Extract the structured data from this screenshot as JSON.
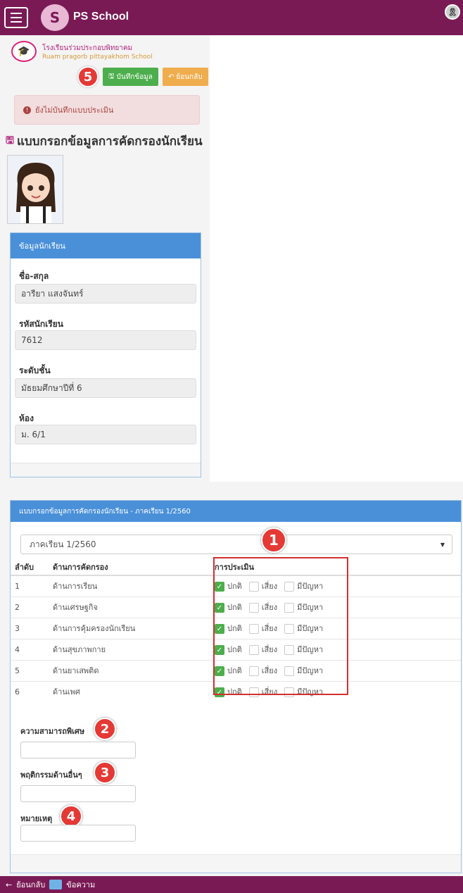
{
  "app": {
    "title": "PS School"
  },
  "school": {
    "name_th": "โรงเรียนร่วมประกอบพิทยาคม",
    "name_en": "Ruam pragorb pittayakhom School"
  },
  "toolbar": {
    "step_badge": "5",
    "save_label": "บันทึกข้อมูล",
    "back_label": "ย้อนกลับ"
  },
  "alert": {
    "text": "ยังไม่บันทึกแบบประเมิน"
  },
  "form": {
    "title": "แบบกรอกข้อมูลการคัดกรองนักเรียน"
  },
  "student_panel": {
    "heading": "ข้อมูลนักเรียน",
    "fields": [
      {
        "label": "ชื่อ-สกุล",
        "value": "อารียา แสงจันทร์"
      },
      {
        "label": "รหัสนักเรียน",
        "value": "7612"
      },
      {
        "label": "ระดับชั้น",
        "value": "มัธยมศึกษาปีที่ 6"
      },
      {
        "label": "ห้อง",
        "value": "ม. 6/1"
      }
    ]
  },
  "screening_panel": {
    "heading": "แบบกรอกข้อมูลการคัดกรองนักเรียน - ภาคเรียน 1/2560",
    "semester_select": "ภาคเรียน 1/2560",
    "badge_1": "1",
    "columns": [
      "ลำดับ",
      "ด้านการคัดกรอง",
      "การประเมิน"
    ],
    "options": [
      "ปกติ",
      "เสี่ยง",
      "มีปัญหา"
    ],
    "rows": [
      {
        "no": "1",
        "aspect": "ด้านการเรียน",
        "selected": 0
      },
      {
        "no": "2",
        "aspect": "ด้านเศรษฐกิจ",
        "selected": 0
      },
      {
        "no": "3",
        "aspect": "ด้านการคุ้มครองนักเรียน",
        "selected": 0
      },
      {
        "no": "4",
        "aspect": "ด้านสุขภาพกาย",
        "selected": 0
      },
      {
        "no": "5",
        "aspect": "ด้านยาเสพติด",
        "selected": 0
      },
      {
        "no": "6",
        "aspect": "ด้านเพศ",
        "selected": 0
      }
    ],
    "extras": [
      {
        "label": "ความสามารถพิเศษ",
        "badge": "2",
        "value": ""
      },
      {
        "label": "พฤติกรรมด้านอื่นๆ",
        "badge": "3",
        "value": ""
      },
      {
        "label": "หมายเหตุ",
        "badge": "4",
        "value": ""
      }
    ]
  },
  "bottom_nav": {
    "back_label": "ย้อนกลับ",
    "message_label": "ข้อความ"
  }
}
